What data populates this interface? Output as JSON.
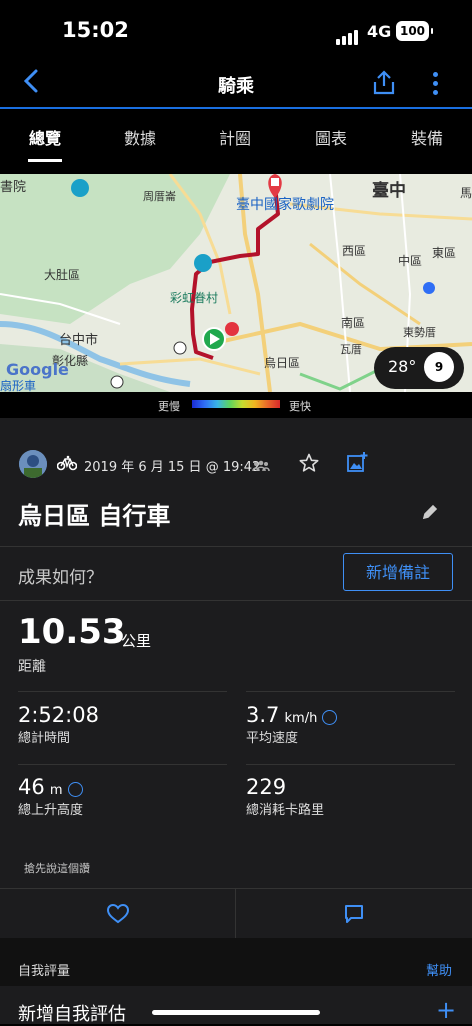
{
  "status_bar": {
    "time": "15:02",
    "network": "4G",
    "battery": "100"
  },
  "nav": {
    "title": "騎乘"
  },
  "tabs": [
    {
      "label": "總覽",
      "active": true
    },
    {
      "label": "數據",
      "active": false
    },
    {
      "label": "計圈",
      "active": false
    },
    {
      "label": "圖表",
      "active": false
    },
    {
      "label": "裝備",
      "active": false
    }
  ],
  "map": {
    "labels": {
      "shuyuan": "書院",
      "zhoucuo": "周厝崙",
      "taichung": "臺中",
      "theater": "臺中國家歌劇院",
      "dadu": "大肚區",
      "xitun": "西區",
      "zhongqu": "中區",
      "dongqu": "東區",
      "rainbow": "彩虹眷村",
      "nanqu": "南區",
      "taichungshi": "台中市",
      "changhua": "彰化縣",
      "dongshi": "東勢厝",
      "wacuo": "瓦厝",
      "wurih": "烏日區",
      "google": "Google",
      "bottomleft": "扇形車",
      "edge": "馬"
    },
    "weather": {
      "temperature": "28°",
      "wind": "9"
    },
    "legend": {
      "slow": "更慢",
      "fast": "更快"
    }
  },
  "activity": {
    "date": "2019 年 6 月 15 日 @ 19:42",
    "title": "烏日區 自行車",
    "question": "成果如何？",
    "add_note": "新增備註",
    "distance": {
      "value": "10.53",
      "unit": "公里",
      "label": "距離"
    },
    "stats": [
      {
        "value": "2:52:08",
        "unit": "",
        "label": "總計時間"
      },
      {
        "value": "3.7",
        "unit": "km/h",
        "label": "平均速度"
      },
      {
        "value": "46",
        "unit": "m",
        "label": "總上升高度"
      },
      {
        "value": "229",
        "unit": "",
        "label": "總消耗卡路里"
      }
    ],
    "like_hint": "搶先說這個讚"
  },
  "self_eval": {
    "label": "自我評量",
    "help": "幫助",
    "add": "新增自我評估"
  },
  "colors": {
    "accent": "#3f8ff5",
    "route": "#b3122a",
    "background": "#1c1c1e"
  }
}
